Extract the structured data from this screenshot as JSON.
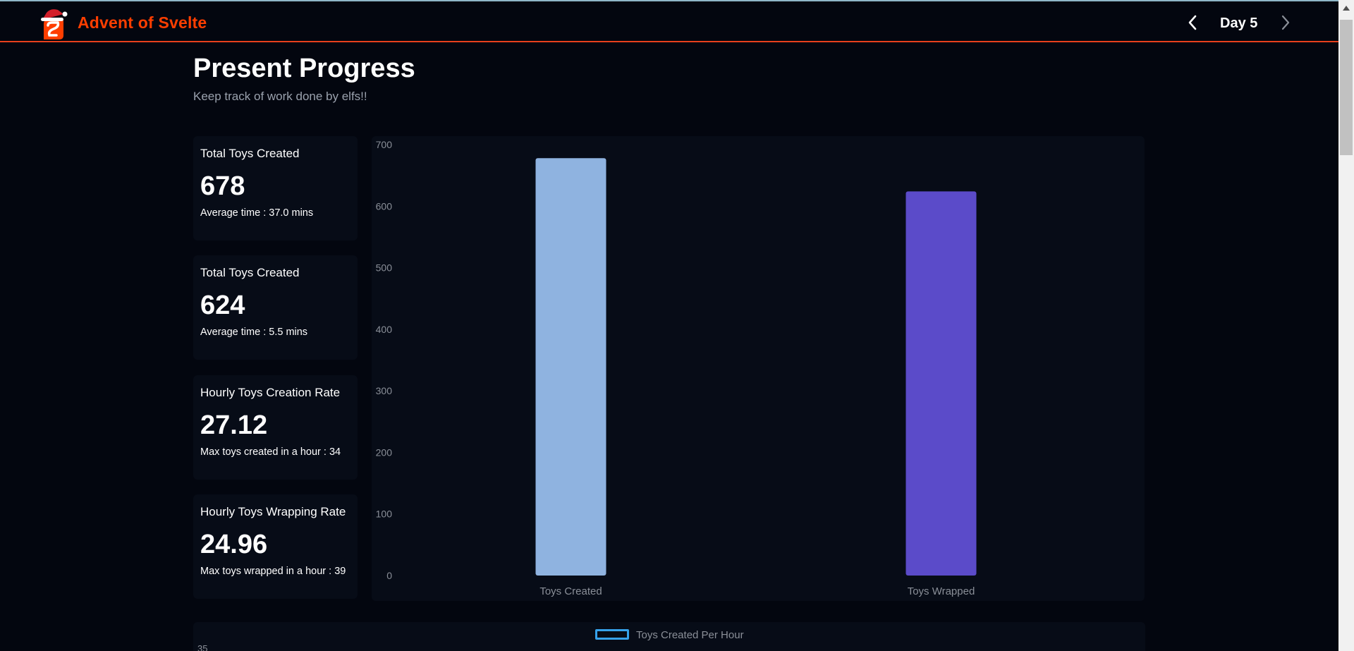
{
  "header": {
    "brand": "Advent of Svelte",
    "day_label": "Day 5",
    "prev_icon": "chevron-left-icon",
    "next_icon": "chevron-right-icon",
    "logo_icon": "svelte-santa-logo-icon",
    "brand_color": "#ff3e00"
  },
  "page": {
    "title": "Present Progress",
    "subtitle": "Keep track of work done by elfs!!"
  },
  "stats": [
    {
      "title": "Total Toys Created",
      "value": "678",
      "sub": "Average time : 37.0 mins"
    },
    {
      "title": "Total Toys Created",
      "value": "624",
      "sub": "Average time : 5.5 mins"
    },
    {
      "title": "Hourly Toys Creation Rate",
      "value": "27.12",
      "sub": "Max toys created in a hour : 34"
    },
    {
      "title": "Hourly Toys Wrapping Rate",
      "value": "24.96",
      "sub": "Max toys wrapped in a hour : 39"
    }
  ],
  "second_chart": {
    "legend_label": "Toys Created Per Hour",
    "legend_color": "#36a2eb",
    "top_tick": "35"
  },
  "chart_data": {
    "type": "bar",
    "categories": [
      "Toys Created",
      "Toys Wrapped"
    ],
    "values": [
      678,
      624
    ],
    "colors": [
      "#8fb3e0",
      "#5b4bc9"
    ],
    "ylim": [
      0,
      700
    ],
    "yticks": [
      0,
      100,
      200,
      300,
      400,
      500,
      600,
      700
    ],
    "title": "",
    "xlabel": "",
    "ylabel": "",
    "grid": false
  }
}
